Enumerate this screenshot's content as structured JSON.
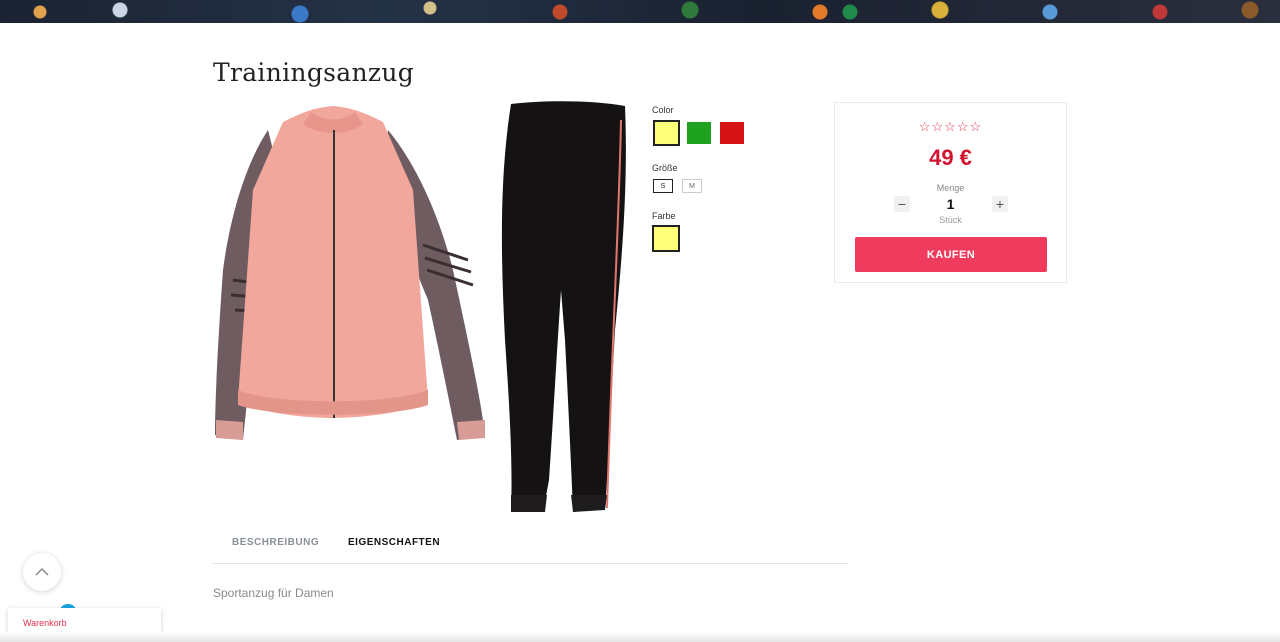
{
  "product": {
    "title": "Trainingsanzug",
    "price": "49 €",
    "rating_stars": "☆☆☆☆☆"
  },
  "options": {
    "color_label": "Color",
    "colors": [
      "#ffff7a",
      "#1fa21f",
      "#d61416"
    ],
    "size_label": "Größe",
    "sizes": [
      "S",
      "M"
    ],
    "farbe_label": "Farbe",
    "farbe_value": "#ffff7a"
  },
  "quantity": {
    "label": "Menge",
    "value": "1",
    "unit": "Stück",
    "minus": "−",
    "plus": "+"
  },
  "buy_button": "KAUFEN",
  "tabs": {
    "beschreibung": "BESCHREIBUNG",
    "eigenschaften": "EIGENSCHAFTEN",
    "content": "Sportanzug für Damen"
  },
  "cart": {
    "label": "Warenkorb"
  },
  "colors": {
    "accent": "#ef3b5d",
    "price": "#d2132f"
  },
  "icons": {
    "scroll_top": "chevron-up-icon"
  }
}
